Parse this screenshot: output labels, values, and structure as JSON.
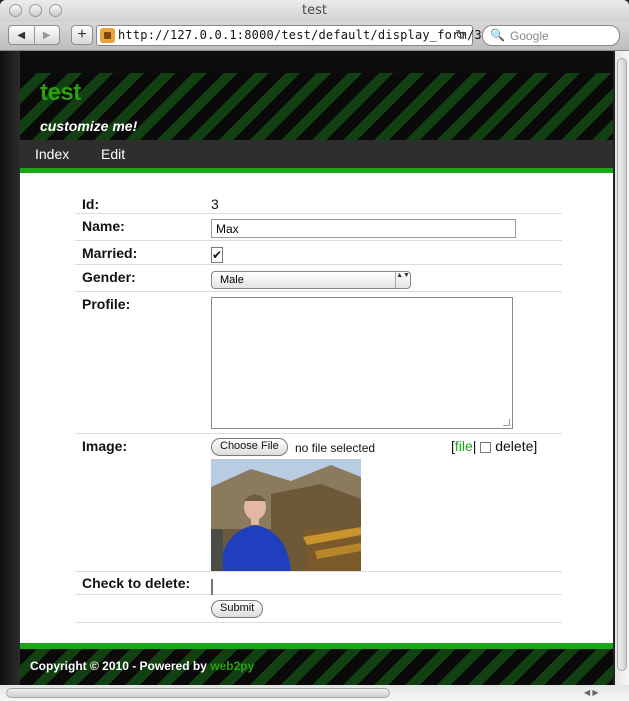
{
  "window": {
    "title": "test"
  },
  "toolbar": {
    "back_label": "◀",
    "forward_label": "▶",
    "plus_label": "+",
    "url": "http://127.0.0.1:8000/test/default/display_form/3",
    "reload_label": "↻",
    "search_placeholder": "Google",
    "search_icon": "🔍"
  },
  "site": {
    "title": "test",
    "subtitle": "customize me!"
  },
  "menu": {
    "items": [
      {
        "label": "Index"
      },
      {
        "label": "Edit"
      }
    ]
  },
  "form": {
    "id_label": "Id:",
    "id_value": "3",
    "name_label": "Name:",
    "name_value": "Max",
    "married_label": "Married:",
    "married_checked": true,
    "married_check_glyph": "✔",
    "gender_label": "Gender:",
    "gender_value": "Male",
    "gender_arrow": "▲▼",
    "profile_label": "Profile:",
    "profile_value": "",
    "image_label": "Image:",
    "choose_file_label": "Choose File",
    "no_file_text": "no file selected",
    "file_link_open": "[",
    "file_link_label": "file",
    "file_link_sep": "|",
    "delete_label": "delete]",
    "delete_check_label": "Check to delete:",
    "submit_label": "Submit"
  },
  "footer": {
    "text": "Copyright © 2010 - Powered by",
    "link": "web2py"
  },
  "colors": {
    "accent_green": "#19a515",
    "title_green": "#2aa012"
  }
}
